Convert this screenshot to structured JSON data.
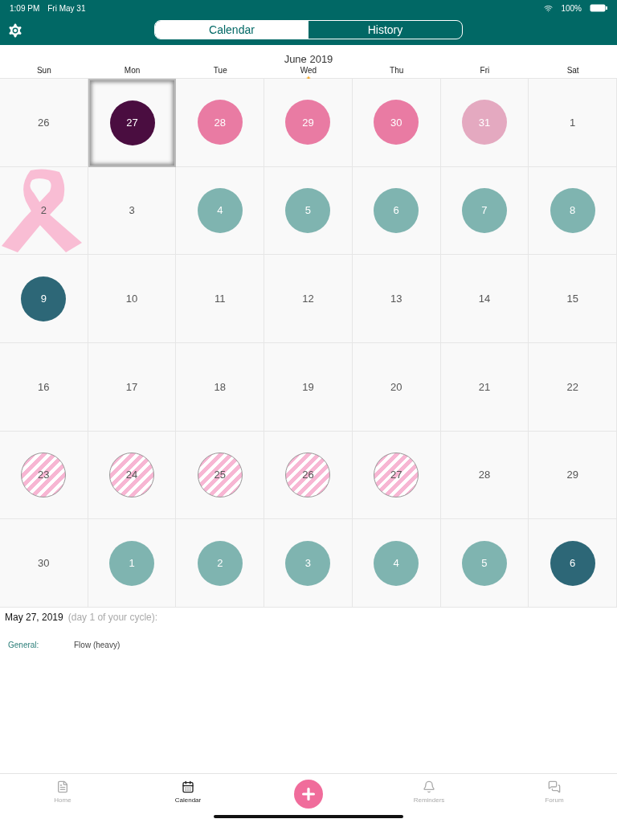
{
  "status_bar": {
    "time": "1:09 PM",
    "date": "Fri May 31",
    "battery": "100%"
  },
  "segments": [
    {
      "label": "Calendar",
      "selected": true
    },
    {
      "label": "History",
      "selected": false
    }
  ],
  "month": "June 2019",
  "weekdays": [
    {
      "label": "Sun",
      "marked": false
    },
    {
      "label": "Mon",
      "marked": false
    },
    {
      "label": "Tue",
      "marked": false
    },
    {
      "label": "Wed",
      "marked": true
    },
    {
      "label": "Thu",
      "marked": false
    },
    {
      "label": "Fri",
      "marked": false
    },
    {
      "label": "Sat",
      "marked": false
    }
  ],
  "days": [
    {
      "label": "26",
      "kind": "plain",
      "selected": false
    },
    {
      "label": "27",
      "kind": "dot",
      "color": "#4a0d40",
      "selected": true
    },
    {
      "label": "28",
      "kind": "dot",
      "color": "#e97ba3",
      "selected": false
    },
    {
      "label": "29",
      "kind": "dot",
      "color": "#e97ba3",
      "selected": false
    },
    {
      "label": "30",
      "kind": "dot",
      "color": "#e97ba3",
      "selected": false
    },
    {
      "label": "31",
      "kind": "dot",
      "color": "#e4a9c0",
      "selected": false
    },
    {
      "label": "1",
      "kind": "plain",
      "selected": false
    },
    {
      "label": "2",
      "kind": "ribbon",
      "selected": false
    },
    {
      "label": "3",
      "kind": "plain",
      "selected": false
    },
    {
      "label": "4",
      "kind": "dot",
      "color": "#7fb4b0",
      "selected": false
    },
    {
      "label": "5",
      "kind": "dot",
      "color": "#7fb4b0",
      "selected": false
    },
    {
      "label": "6",
      "kind": "dot",
      "color": "#7fb4b0",
      "selected": false
    },
    {
      "label": "7",
      "kind": "dot",
      "color": "#7fb4b0",
      "selected": false
    },
    {
      "label": "8",
      "kind": "dot",
      "color": "#7fb4b0",
      "selected": false
    },
    {
      "label": "9",
      "kind": "dot",
      "color": "#2d6777",
      "selected": false
    },
    {
      "label": "10",
      "kind": "plain",
      "selected": false
    },
    {
      "label": "11",
      "kind": "plain",
      "selected": false
    },
    {
      "label": "12",
      "kind": "plain",
      "selected": false
    },
    {
      "label": "13",
      "kind": "plain",
      "selected": false
    },
    {
      "label": "14",
      "kind": "plain",
      "selected": false
    },
    {
      "label": "15",
      "kind": "plain",
      "selected": false
    },
    {
      "label": "16",
      "kind": "plain",
      "selected": false
    },
    {
      "label": "17",
      "kind": "plain",
      "selected": false
    },
    {
      "label": "18",
      "kind": "plain",
      "selected": false
    },
    {
      "label": "19",
      "kind": "plain",
      "selected": false
    },
    {
      "label": "20",
      "kind": "plain",
      "selected": false
    },
    {
      "label": "21",
      "kind": "plain",
      "selected": false
    },
    {
      "label": "22",
      "kind": "plain",
      "selected": false
    },
    {
      "label": "23",
      "kind": "striped",
      "selected": false
    },
    {
      "label": "24",
      "kind": "striped",
      "selected": false
    },
    {
      "label": "25",
      "kind": "striped",
      "selected": false
    },
    {
      "label": "26",
      "kind": "striped",
      "selected": false
    },
    {
      "label": "27",
      "kind": "striped",
      "selected": false
    },
    {
      "label": "28",
      "kind": "plain",
      "selected": false
    },
    {
      "label": "29",
      "kind": "plain",
      "selected": false
    },
    {
      "label": "30",
      "kind": "plain",
      "selected": false
    },
    {
      "label": "1",
      "kind": "dot",
      "color": "#7fb4b0",
      "selected": false
    },
    {
      "label": "2",
      "kind": "dot",
      "color": "#7fb4b0",
      "selected": false
    },
    {
      "label": "3",
      "kind": "dot",
      "color": "#7fb4b0",
      "selected": false
    },
    {
      "label": "4",
      "kind": "dot",
      "color": "#7fb4b0",
      "selected": false
    },
    {
      "label": "5",
      "kind": "dot",
      "color": "#7fb4b0",
      "selected": false
    },
    {
      "label": "6",
      "kind": "dot",
      "color": "#2d6777",
      "selected": false
    }
  ],
  "detail": {
    "date": "May 27, 2019",
    "note": "(day 1 of your cycle):",
    "entries": [
      {
        "label": "General:",
        "value": "Flow (heavy)"
      }
    ]
  },
  "tab_bar": [
    {
      "kind": "tab",
      "label": "Home",
      "selected": false
    },
    {
      "kind": "tab",
      "label": "Calendar",
      "selected": true
    },
    {
      "kind": "add"
    },
    {
      "kind": "tab",
      "label": "Reminders",
      "selected": false
    },
    {
      "kind": "tab",
      "label": "Forum",
      "selected": false
    }
  ]
}
